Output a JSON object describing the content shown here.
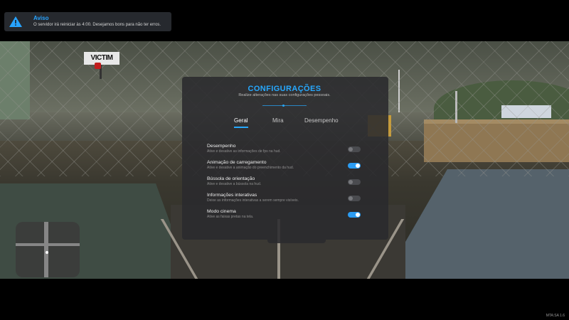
{
  "notification": {
    "icon": "warning-icon",
    "title": "Aviso",
    "message": "O servidor irá reiniciar às 4:00. Desejamos bons para não ter erros."
  },
  "settings": {
    "title": "CONFIGURAÇÕES",
    "subtitle": "Realize alterações nas suas configurações pessoais.",
    "tabs": [
      {
        "label": "Geral",
        "active": true
      },
      {
        "label": "Mira",
        "active": false
      },
      {
        "label": "Desempenho",
        "active": false
      }
    ],
    "options": [
      {
        "label": "Desempenho",
        "description": "Ative e desative as informações de fps na hud.",
        "enabled": false
      },
      {
        "label": "Animação de carregamento",
        "description": "Ative e desative a animação do preenchimento da hud.",
        "enabled": true
      },
      {
        "label": "Bússola de orientação",
        "description": "Ative e desative a bússola na hud.",
        "enabled": false
      },
      {
        "label": "Informações interativas",
        "description": "Deixe as informações interativas a serem sempre visíveis.",
        "enabled": false
      },
      {
        "label": "Modo cinema",
        "description": "Ative as faixas pretas na tela.",
        "enabled": true
      }
    ],
    "accent_color": "#26a9ff"
  },
  "scene": {
    "sign_text": "VICTIM"
  },
  "footer": {
    "version": "MTA:SA 1.6"
  }
}
